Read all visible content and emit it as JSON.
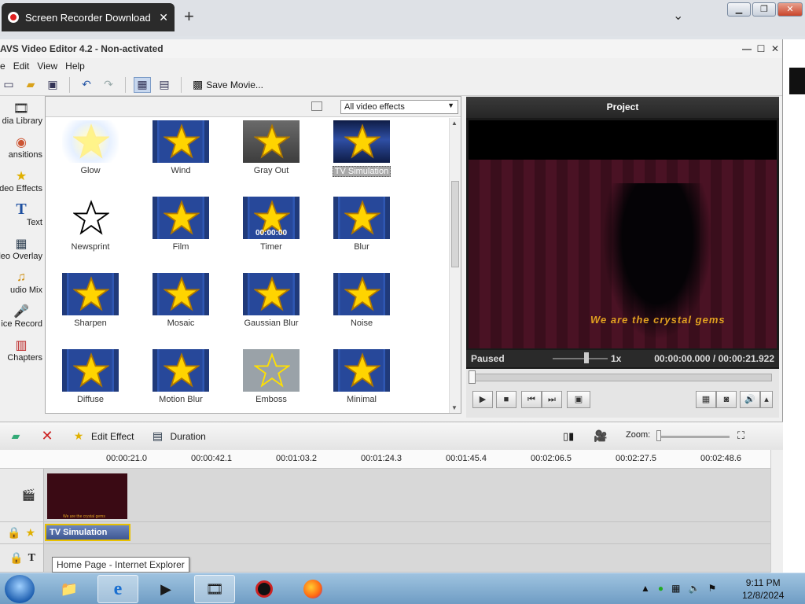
{
  "browser": {
    "tab_title": "Screen Recorder Download - Be",
    "new_tab": "+",
    "tab_close": "✕",
    "tab_menu": "⌄",
    "minimize": "▁",
    "maximize": "❐",
    "close": "✕"
  },
  "app": {
    "title": "AVS Video Editor 4.2 - Non-activated",
    "menu": [
      "e",
      "Edit",
      "View",
      "Help"
    ],
    "toolbar": {
      "save_movie": "Save Movie..."
    }
  },
  "sidebar": {
    "items": [
      {
        "label": "dia Library",
        "icon": "film-icon"
      },
      {
        "label": "ansitions",
        "icon": "transitions-icon"
      },
      {
        "label": "deo Effects",
        "icon": "star-icon"
      },
      {
        "label": "Text",
        "icon": "text-icon"
      },
      {
        "label": "deo Overlay",
        "icon": "overlay-icon"
      },
      {
        "label": "udio Mix",
        "icon": "audio-icon"
      },
      {
        "label": "ice Record",
        "icon": "mic-icon"
      },
      {
        "label": "Chapters",
        "icon": "chapters-icon"
      }
    ]
  },
  "effects": {
    "filter": "All video effects",
    "items": [
      {
        "label": "Glow"
      },
      {
        "label": "Wind"
      },
      {
        "label": "Gray Out"
      },
      {
        "label": "TV Simulation"
      },
      {
        "label": "Newsprint"
      },
      {
        "label": "Film"
      },
      {
        "label": "Timer"
      },
      {
        "label": "Blur"
      },
      {
        "label": "Sharpen"
      },
      {
        "label": "Mosaic"
      },
      {
        "label": "Gaussian Blur"
      },
      {
        "label": "Noise"
      },
      {
        "label": "Diffuse"
      },
      {
        "label": "Motion Blur"
      },
      {
        "label": "Emboss"
      },
      {
        "label": "Minimal"
      }
    ],
    "selected": "TV Simulation",
    "timer_overlay": "00:00:00"
  },
  "preview": {
    "title": "Project",
    "caption": "We are the crystal gems",
    "status": "Paused",
    "speed": "1x",
    "time": "00:00:00.000  /  00:00:21.922"
  },
  "timeline": {
    "edit_effect": "Edit Effect",
    "duration": "Duration",
    "zoom": "Zoom:",
    "ruler": [
      "00:00:21.0",
      "00:00:42.1",
      "00:01:03.2",
      "00:01:24.3",
      "00:01:45.4",
      "00:02:06.5",
      "00:02:27.5",
      "00:02:48.6"
    ],
    "effect_clip": "TV Simulation",
    "clip_caption": "We are the crystal gems",
    "tooltip": "Home Page - Internet Explorer"
  },
  "taskbar": {
    "time": "9:11 PM",
    "date": "12/8/2024"
  },
  "colors": {
    "accent_blue": "#2f57b3",
    "star_yellow": "#ffd400",
    "preview_bg": "#1a1a1a",
    "selection_gold": "#e8c000"
  }
}
